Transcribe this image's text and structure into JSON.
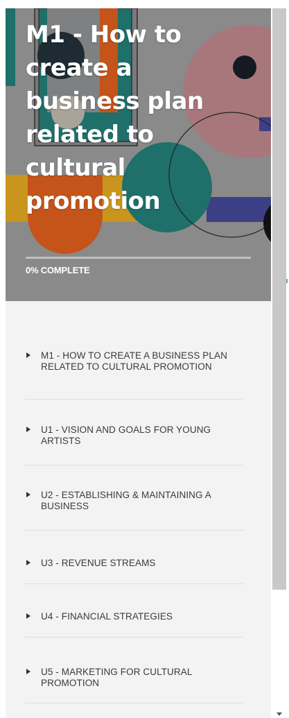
{
  "course": {
    "title": "M1 - How to create a business plan related to cultural promotion",
    "progress_label": "0% COMPLETE",
    "progress_fraction": 0
  },
  "lessons": [
    {
      "label": "M1 - HOW TO CREATE A BUSINESS PLAN RELATED TO CULTURAL PROMOTION"
    },
    {
      "label": "U1 - VISION AND GOALS FOR YOUNG ARTISTS"
    },
    {
      "label": "U2 - ESTABLISHING & MAINTAINING A BUSINESS"
    },
    {
      "label": "U3 - REVENUE STREAMS"
    },
    {
      "label": "U4 - FINANCIAL STRATEGIES"
    },
    {
      "label": "U5 - MARKETING FOR CULTURAL PROMOTION"
    }
  ],
  "icons": {
    "lesson_expand": "caret-right-icon",
    "scroll_down": "scroll-down-arrow-icon"
  },
  "colors": {
    "hero_background": "#8a8a8a",
    "panel_background": "#f3f3f3",
    "teal": "#1f6f6a",
    "mustard": "#c9951d",
    "rust": "#c4541a",
    "pink": "#a8777b",
    "navy": "#3d3f86",
    "text": "#3a3a3a"
  }
}
